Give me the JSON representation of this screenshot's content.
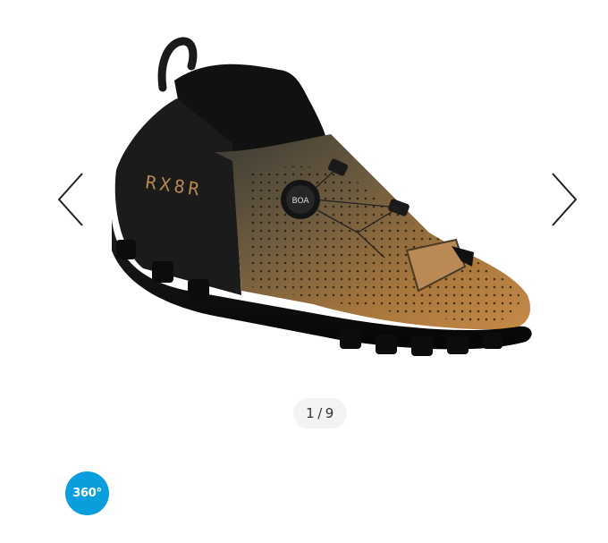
{
  "gallery": {
    "current_page": 1,
    "total_pages": 9,
    "counter_current": "1",
    "counter_separator": "/",
    "counter_total": "9",
    "prev_icon": "chevron-left-icon",
    "next_icon": "chevron-right-icon"
  },
  "product": {
    "model_print": "RX8R",
    "dial_print": "BOA"
  },
  "view360": {
    "label": "360°",
    "icon": "play-360-icon",
    "color": "#0a9fdc"
  },
  "colors": {
    "shoe_bronze": "#a9793f",
    "shoe_black": "#151515"
  }
}
